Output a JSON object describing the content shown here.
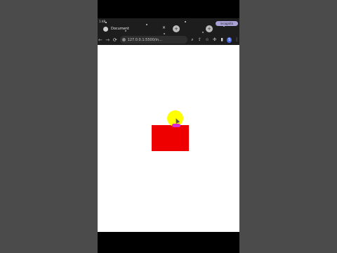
{
  "status_bar": {
    "time": "1:48"
  },
  "browser": {
    "tab": {
      "title": "Document",
      "close": "×"
    },
    "new_tab": "+",
    "extra_button": "+",
    "profile_pill": "incognito",
    "nav": {
      "back": "←",
      "forward": "→",
      "reload": "⟳"
    },
    "address": "127.0.0.1:5500/in...",
    "icons": [
      "zoom-icon",
      "share-icon",
      "star-icon",
      "extensions-icon",
      "sidebar-icon",
      "profile-icon",
      "menu-icon"
    ],
    "tool_glyphs": {
      "zoom": "⌕",
      "share": "⇪",
      "star": "☆",
      "extensions": "✣",
      "sidebar": "▮",
      "menu": "⋮"
    },
    "avatar_initial": "S"
  },
  "page": {
    "background": "#ffffff",
    "box_color": "#ee0000",
    "touch_color": "#ffff00",
    "cursor_color": "#d62bd6"
  }
}
